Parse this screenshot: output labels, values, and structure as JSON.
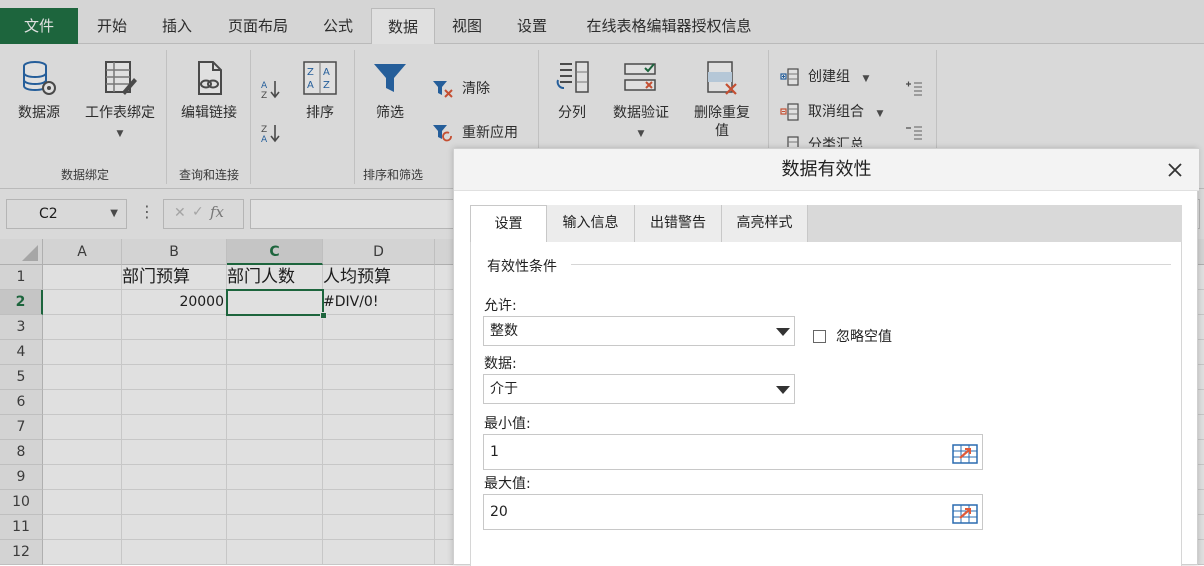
{
  "tabs": {
    "file": "文件",
    "items": [
      "开始",
      "插入",
      "页面布局",
      "公式",
      "数据",
      "视图",
      "设置",
      "在线表格编辑器授权信息"
    ],
    "active": "数据"
  },
  "ribbon": {
    "groups": {
      "binding": "数据绑定",
      "query": "查询和连接",
      "sort_filter": "排序和筛选"
    },
    "buttons": {
      "datasource": "数据源",
      "sheet_binding": "工作表绑定",
      "edit_links": "编辑链接",
      "sort": "排序",
      "filter": "筛选",
      "clear": "清除",
      "reapply": "重新应用",
      "split_column": "分列",
      "data_validation": "数据验证",
      "remove_dup_1": "删除重复",
      "remove_dup_2": "值",
      "create_group": "创建组",
      "ungroup": "取消组合",
      "subtotal": "分类汇总"
    }
  },
  "formula_bar": {
    "name_box": "C2",
    "fx": "fx",
    "formula": ""
  },
  "grid": {
    "columns": [
      "A",
      "B",
      "C",
      "D"
    ],
    "rows": [
      "1",
      "2",
      "3",
      "4",
      "5",
      "6",
      "7",
      "8",
      "9",
      "10",
      "11",
      "12"
    ],
    "selected_column": "C",
    "selected_row": "2",
    "cells": {
      "B1": "部门预算",
      "C1": "部门人数",
      "D1": "人均预算",
      "B2": "20000",
      "C2": "",
      "D2": "#DIV/0!"
    }
  },
  "dialog": {
    "title": "数据有效性",
    "tabs": [
      "设置",
      "输入信息",
      "出错警告",
      "高亮样式"
    ],
    "active_tab": "设置",
    "section": "有效性条件",
    "allow_label": "允许:",
    "allow_value": "整数",
    "ignore_blank": "忽略空值",
    "ignore_blank_checked": false,
    "data_label": "数据:",
    "data_value": "介于",
    "min_label": "最小值:",
    "min_value": "1",
    "max_label": "最大值:",
    "max_value": "20"
  },
  "colors": {
    "accent": "#217346"
  }
}
